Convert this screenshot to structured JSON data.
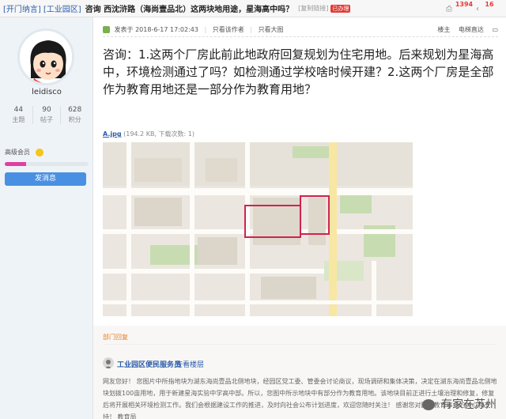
{
  "thread_header": {
    "tags": [
      "[开门纳言]",
      "[工业园区]"
    ],
    "title": "咨询 西沈浒路（海尚壹品北）这两块地用途，星海高中吗？",
    "copy_link": "[复制链接]",
    "badge": "已办理"
  },
  "stats": {
    "views": "1394",
    "replies": "16"
  },
  "user": {
    "username": "leidisco",
    "threads_label": "主题",
    "threads_value": "44",
    "posts_label": "帖子",
    "posts_value": "90",
    "points_label": "积分",
    "points_value": "628",
    "rank": "高级会员",
    "rank_progress": 0.25,
    "send_message": "发消息"
  },
  "post": {
    "published": "发表于 2018-6-17 17:02:43",
    "author_only": "只看该作者",
    "view_large": "只看大图",
    "floor_label": "楼主",
    "jump_label": "电梯直达",
    "content": "咨询：1.这两个厂房此前此地政府回复规划为住宅用地。后来规划为星海高中，环境检测通过了吗？如检测通过学校啥时候开建？2.这两个厂房是全部作为教育用地还是一部分作为教育用地？",
    "attachment_name": "A.jpg",
    "attachment_info": "(194.2 KB, 下载次数: 1)"
  },
  "reply": {
    "section_label": "部门回复",
    "author": "工业园区便民服务员",
    "view_floor": "查看楼层",
    "text": "网友您好！ 您图片中所指地块为湖东海尚壹品北侧地块，经园区党工委、管委会讨论商议，现场调研和集体决策，决定在湖东海尚壹品北侧地块划拨100亩用地，用于新建星海实验中学高中部。所以，您图中所示地块中有部分作为教育用地。该地块目前正进行土壤治理和修复，修复后将开展相关环境检测工作。我们会根据建设工作的推进，及时向社会公布计划进度，欢迎您随时关注！ 感谢您对园区教育事业的关心和支持！ 教育局"
  },
  "watermark": "有家在苏州",
  "colors": {
    "link_blue": "#2a5caa",
    "count_red": "#e53935",
    "button_blue": "#4a90e2",
    "section_orange": "#e67e22",
    "parcel_red": "#d0234e"
  }
}
